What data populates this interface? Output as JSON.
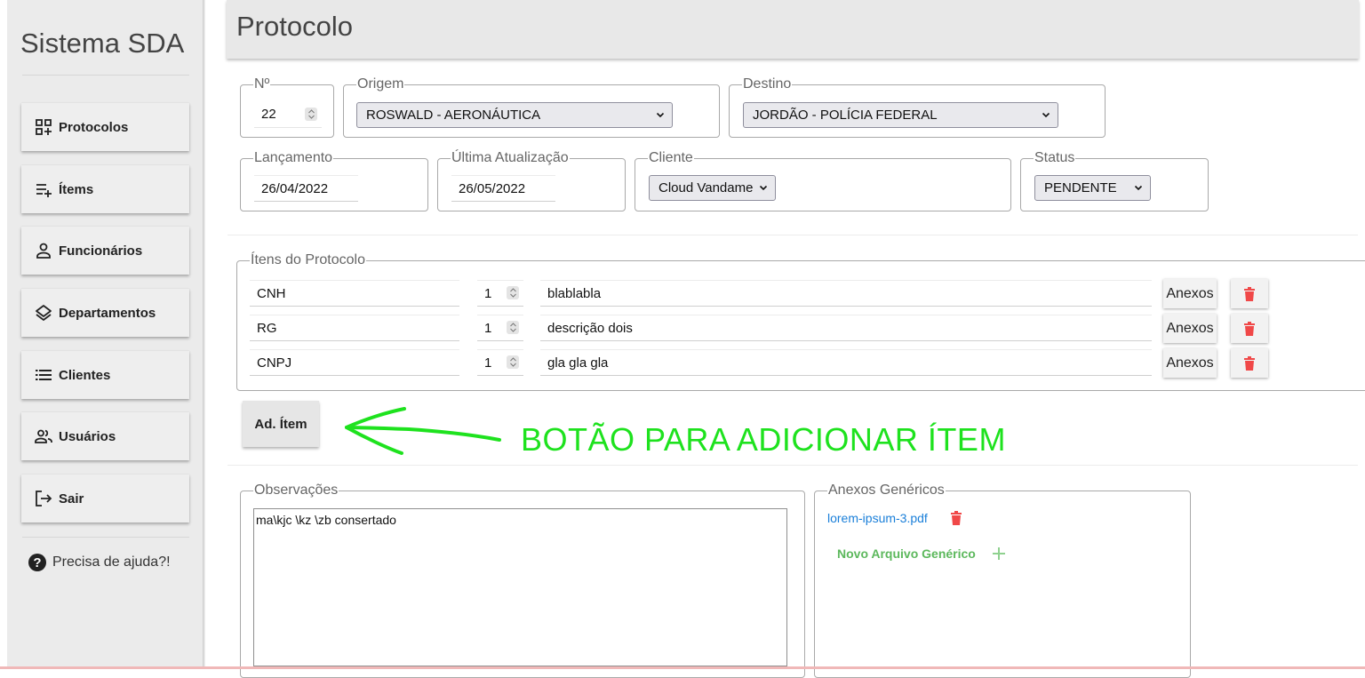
{
  "app": {
    "title": "Sistema SDA"
  },
  "sidebar": {
    "items": [
      {
        "label": "Protocolos",
        "icon": "grid-add-icon"
      },
      {
        "label": "Ítems",
        "icon": "list-add-icon"
      },
      {
        "label": "Funcionários",
        "icon": "person-icon"
      },
      {
        "label": "Departamentos",
        "icon": "layers-icon"
      },
      {
        "label": "Clientes",
        "icon": "list-icon"
      },
      {
        "label": "Usuários",
        "icon": "group-icon"
      },
      {
        "label": "Sair",
        "icon": "logout-icon"
      }
    ],
    "help": "Precisa de ajuda?!"
  },
  "header": {
    "title": "Protocolo"
  },
  "form": {
    "numero": {
      "legend": "Nº",
      "value": "22"
    },
    "origem": {
      "legend": "Origem",
      "value": "ROSWALD - AERONÁUTICA"
    },
    "destino": {
      "legend": "Destino",
      "value": "JORDÃO - POLÍCIA FEDERAL"
    },
    "lancamento": {
      "legend": "Lançamento",
      "value": "26/04/2022"
    },
    "atualizacao": {
      "legend": "Última Atualização",
      "value": "26/05/2022"
    },
    "cliente": {
      "legend": "Cliente",
      "value": "Cloud Vandame"
    },
    "status": {
      "legend": "Status",
      "value": "PENDENTE"
    }
  },
  "items_section": {
    "legend": "Ítens do Protocolo",
    "anexos_label": "Anexos",
    "rows": [
      {
        "name": "CNH",
        "qty": "1",
        "desc": "blablabla"
      },
      {
        "name": "RG",
        "qty": "1",
        "desc": "descrição dois"
      },
      {
        "name": "CNPJ",
        "qty": "1",
        "desc": "gla gla gla"
      }
    ],
    "add_label": "Ad. Ítem"
  },
  "annotation": {
    "text": "BOTÃO PARA ADICIONAR ÍTEM",
    "color": "#1ee21e"
  },
  "observacoes": {
    "legend": "Observações",
    "value": "ma\\kjc \\kz \\zb  consertado"
  },
  "anexos_genericos": {
    "legend": "Anexos Genéricos",
    "files": [
      "lorem-ipsum-3.pdf"
    ],
    "new_label": "Novo Arquivo Genérico"
  },
  "colors": {
    "danger": "#f04848",
    "link": "#1a7fd9",
    "success": "#5cb85c"
  }
}
